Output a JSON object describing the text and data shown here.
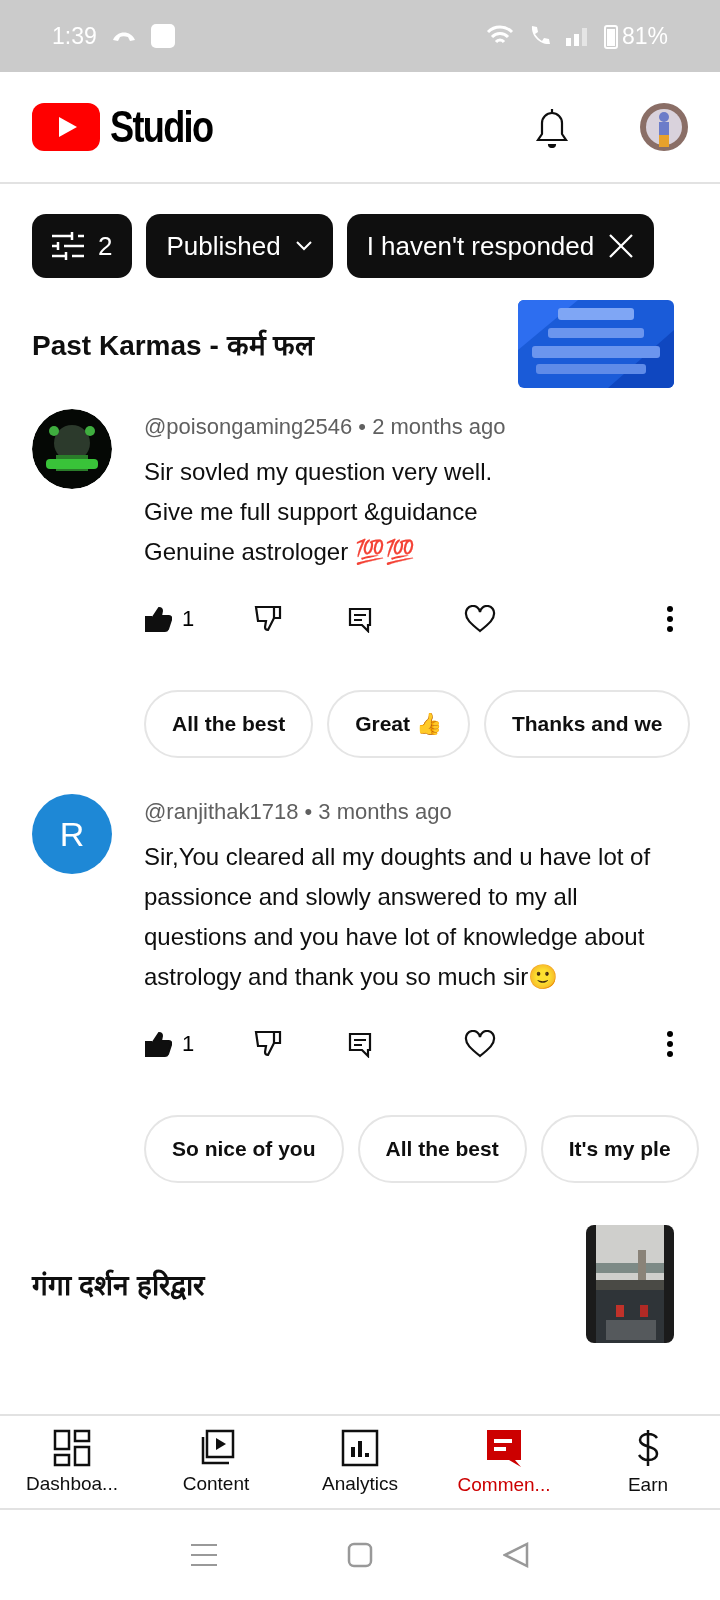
{
  "status_bar": {
    "time": "1:39",
    "battery": "81%"
  },
  "header": {
    "title": "Studio"
  },
  "filters": [
    {
      "kind": "count",
      "label": "2"
    },
    {
      "kind": "dropdown",
      "label": "Published"
    },
    {
      "kind": "removable",
      "label": "I haven't responded"
    }
  ],
  "videos": [
    {
      "title": "Past Karmas - कर्म फल",
      "comments": [
        {
          "meta": "@poisongaming2546 • 2 months ago",
          "body": "Sir sovled my question very well.\nGive me full support &guidance\nGenuine astrologer 💯💯",
          "likes": "1",
          "liked": true,
          "hearted": false,
          "replies": [
            "All the best",
            "Great 👍",
            "Thanks and we"
          ]
        },
        {
          "meta": "@ranjithak1718 • 3 months ago",
          "avatar_letter": "R",
          "body": "Sir,You cleared all  my doughts and u have lot of passionce and slowly answered to my all questions and you have lot of knowledge about astrology and thank you so much sir🙂",
          "likes": "1",
          "liked": true,
          "hearted": false,
          "replies": [
            "So nice of you",
            "All the best",
            "It's my ple"
          ]
        }
      ]
    },
    {
      "title": "गंगा दर्शन हरिद्वार"
    }
  ],
  "bottom_nav": [
    {
      "label": "Dashboa...",
      "selected": false
    },
    {
      "label": "Content",
      "selected": false
    },
    {
      "label": "Analytics",
      "selected": false
    },
    {
      "label": "Commen...",
      "selected": true
    },
    {
      "label": "Earn",
      "selected": false
    }
  ]
}
